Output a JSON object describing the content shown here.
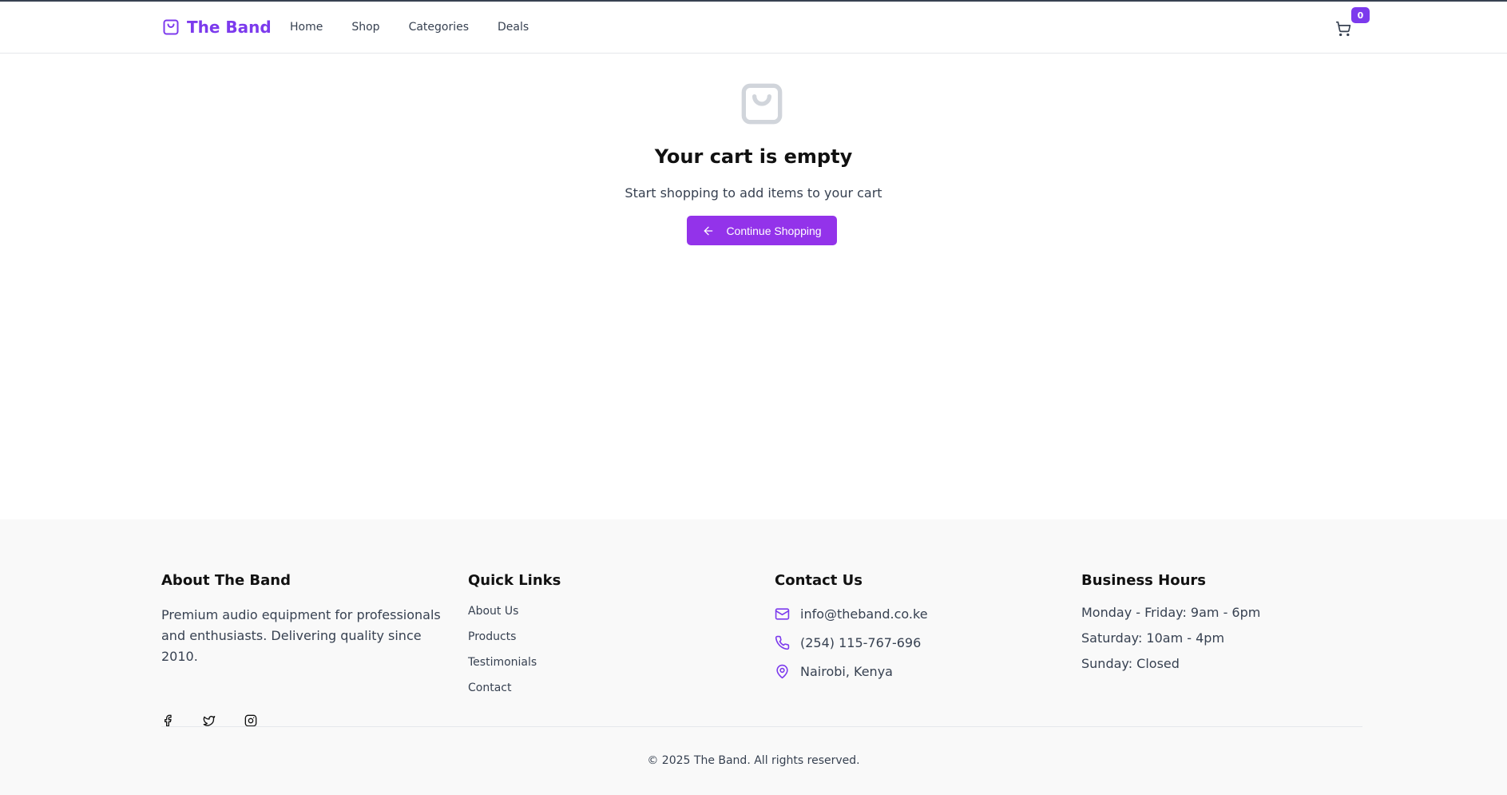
{
  "colors": {
    "brand": "#7c3aed",
    "button": "#9333ea",
    "footer_bg": "#f9f9f9"
  },
  "header": {
    "brand_name": "The Band",
    "brand_icon": "shopping-bag-icon",
    "nav": [
      "Home",
      "Shop",
      "Categories",
      "Deals"
    ],
    "cart_icon": "cart-icon",
    "cart_count": "0"
  },
  "empty_cart": {
    "icon": "shopping-bag-icon",
    "title": "Your cart is empty",
    "subtitle": "Start shopping to add items to your cart",
    "button_label": "Continue Shopping",
    "button_icon": "arrow-left-icon"
  },
  "footer": {
    "about": {
      "heading": "About The Band",
      "text": "Premium audio equipment for professionals and enthusiasts. Delivering quality since 2010.",
      "socials": [
        "facebook-icon",
        "twitter-icon",
        "instagram-icon"
      ]
    },
    "quick_links": {
      "heading": "Quick Links",
      "links": [
        "About Us",
        "Products",
        "Testimonials",
        "Contact"
      ]
    },
    "contact": {
      "heading": "Contact Us",
      "email": "info@theband.co.ke",
      "phone": "(254) 115-767-696",
      "location": "Nairobi, Kenya"
    },
    "hours": {
      "heading": "Business Hours",
      "lines": [
        "Monday - Friday: 9am - 6pm",
        "Saturday: 10am - 4pm",
        "Sunday: Closed"
      ]
    },
    "copyright": "© 2025 The Band. All rights reserved."
  }
}
